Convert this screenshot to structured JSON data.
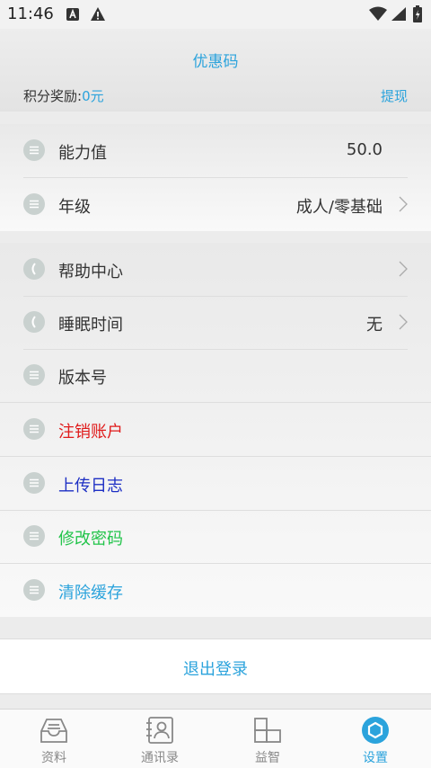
{
  "status": {
    "time": "11:46"
  },
  "header": {
    "title": "优惠码",
    "reward_label": "积分奖励:",
    "reward_value": "0元",
    "withdraw": "提现"
  },
  "group1": [
    {
      "label": "能力值",
      "value": "50.0"
    },
    {
      "label": "年级",
      "value": "成人/零基础"
    }
  ],
  "group2": [
    {
      "label": "帮助中心",
      "value": ""
    },
    {
      "label": "睡眠时间",
      "value": "无"
    },
    {
      "label": "版本号",
      "value": ""
    },
    {
      "label": "注销账户",
      "color": "#e01b1b"
    },
    {
      "label": "上传日志",
      "color": "#1d2fc4"
    },
    {
      "label": "修改密码",
      "color": "#22c44a"
    },
    {
      "label": "清除缓存",
      "color": "#2ba3dc"
    }
  ],
  "logout": "退出登录",
  "tabs": [
    {
      "label": "资料",
      "icon": "inbox-icon"
    },
    {
      "label": "通讯录",
      "icon": "contacts-icon"
    },
    {
      "label": "益智",
      "icon": "grid-icon"
    },
    {
      "label": "设置",
      "icon": "settings-icon"
    }
  ],
  "colors": {
    "accent": "#2ba3dc"
  }
}
